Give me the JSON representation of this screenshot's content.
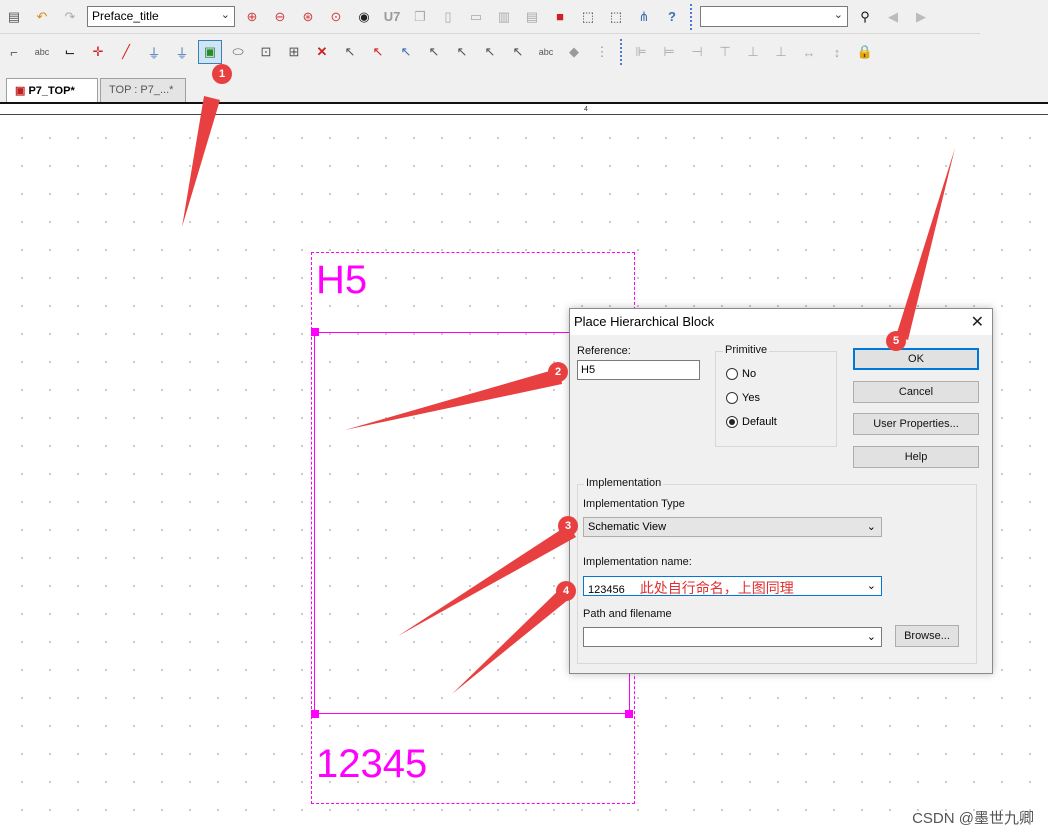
{
  "toolbar": {
    "part_combo_value": "Preface_title",
    "search_combo_value": "",
    "row1_icons": [
      "paste-icon",
      "undo-icon",
      "redo-icon"
    ],
    "row1_icons_b": [
      "zoom-in-icon",
      "zoom-out-icon",
      "zoom-area-icon",
      "zoom-all-icon",
      "eye-icon",
      "u7-icon",
      "copy-page-icon",
      "new-page-icon",
      "page-icon",
      "pages-icon",
      "page-small-icon",
      "red-square-icon",
      "select-area-icon",
      "select-more-icon",
      "tree-icon",
      "help-icon"
    ],
    "row2_icons": [
      "wire-bus-icon",
      "net-alias-icon",
      "wire-icon",
      "junction-icon",
      "no-connect-icon",
      "power-icon",
      "ground-icon",
      "hierarchical-block-icon",
      "port-icon",
      "pin-icon",
      "off-page-icon",
      "delete-icon",
      "pointer1-icon",
      "pointer2-icon",
      "pointer3-icon",
      "pointer4-icon",
      "pointer5-icon",
      "pointer6-icon",
      "pointer7-icon",
      "text-add-icon",
      "diamond-icon",
      "bus-entry-icon"
    ],
    "row2_align_icons": [
      "align-left-icon",
      "align-center-icon",
      "align-right-icon",
      "align-top-icon",
      "align-middle-icon",
      "align-bottom-icon",
      "distribute-h-icon",
      "distribute-v-icon",
      "lock-icon"
    ]
  },
  "tabs": [
    {
      "label": "P7_TOP*"
    },
    {
      "label": "TOP : P7_...*"
    }
  ],
  "ruler_mark": "4",
  "schematic": {
    "reference_text": "H5",
    "implementation_text": "12345",
    "color": "#ff00ff"
  },
  "dialog": {
    "title": "Place Hierarchical Block",
    "reference_label": "Reference:",
    "reference_value": "H5",
    "primitive_label": "Primitive",
    "primitive_options": [
      "No",
      "Yes",
      "Default"
    ],
    "primitive_selected": "Default",
    "buttons": {
      "ok": "OK",
      "cancel": "Cancel",
      "user_properties": "User Properties...",
      "help": "Help",
      "browse": "Browse..."
    },
    "implementation_group": "Implementation",
    "implementation_type_label": "Implementation Type",
    "implementation_type_value": "Schematic View",
    "implementation_name_label": "Implementation name:",
    "implementation_name_value": "123456",
    "implementation_name_note": "此处自行命名，上图同理",
    "path_label": "Path and filename",
    "path_value": ""
  },
  "annotations": {
    "color": "#e84040",
    "badges": [
      "1",
      "2",
      "3",
      "4",
      "5"
    ]
  },
  "watermark": "CSDN @墨世九卿"
}
